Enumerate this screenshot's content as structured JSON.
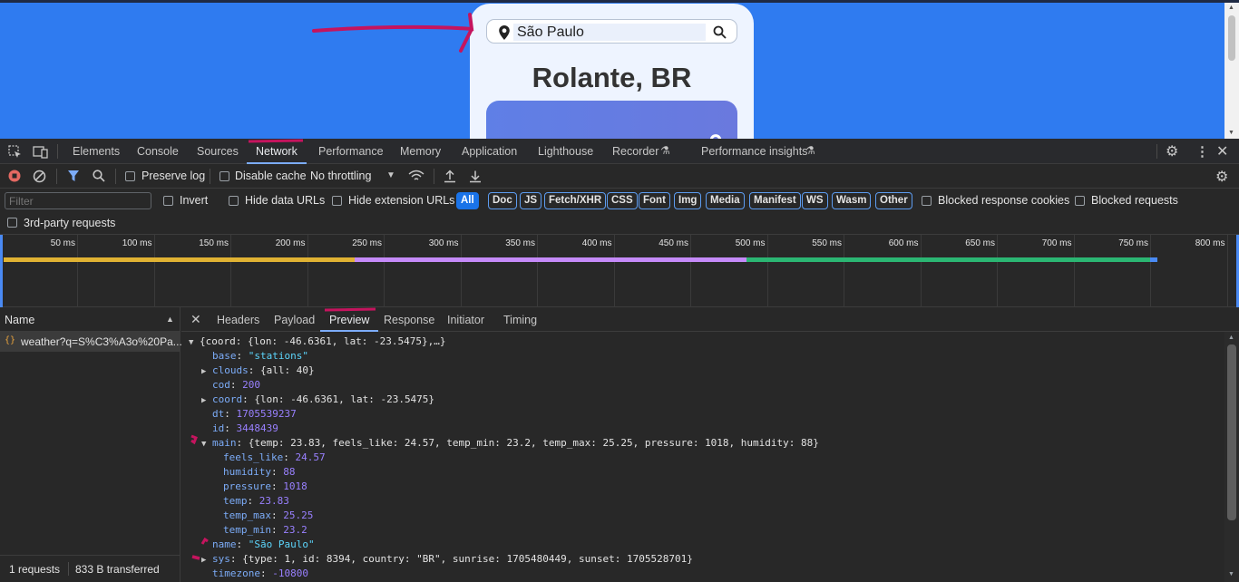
{
  "page": {
    "search_value": "São Paulo",
    "city_title": "Rolante, BR",
    "temp_fragment": "°"
  },
  "devtools": {
    "tabs": [
      "Elements",
      "Console",
      "Sources",
      "Network",
      "Performance",
      "Memory",
      "Application",
      "Lighthouse",
      "Recorder",
      "Performance insights"
    ],
    "active_tab": "Network",
    "toolbar": {
      "preserve_log": "Preserve log",
      "disable_cache": "Disable cache",
      "throttling": "No throttling"
    },
    "filter": {
      "placeholder": "Filter",
      "invert": "Invert",
      "hide_data_urls": "Hide data URLs",
      "hide_extension_urls": "Hide extension URLs",
      "chips": [
        "All",
        "Doc",
        "JS",
        "Fetch/XHR",
        "CSS",
        "Font",
        "Img",
        "Media",
        "Manifest",
        "WS",
        "Wasm",
        "Other"
      ],
      "blocked_response_cookies": "Blocked response cookies",
      "blocked_requests": "Blocked requests",
      "third_party": "3rd-party requests"
    },
    "timeline_ticks": [
      "50 ms",
      "100 ms",
      "150 ms",
      "200 ms",
      "250 ms",
      "300 ms",
      "350 ms",
      "400 ms",
      "450 ms",
      "500 ms",
      "550 ms",
      "600 ms",
      "650 ms",
      "700 ms",
      "750 ms",
      "800 ms"
    ],
    "timeline_colors": {
      "waiting": "#e0b233",
      "receiving": "#c58af9",
      "content": "#2bb673",
      "end": "#4a8af4"
    },
    "name_header": "Name",
    "request_name": "weather?q=S%C3%A3o%20Pa...",
    "status": {
      "requests": "1 requests",
      "transferred": "833 B transferred"
    },
    "detail_tabs": [
      "Headers",
      "Payload",
      "Preview",
      "Response",
      "Initiator",
      "Timing"
    ],
    "active_detail_tab": "Preview",
    "preview": {
      "root": "{coord: {lon: -46.6361, lat: -23.5475},…}",
      "base_key": "base",
      "base_val": "\"stations\"",
      "clouds_key": "clouds",
      "clouds_val": "{all: 40}",
      "cod_key": "cod",
      "cod_val": "200",
      "coord_key": "coord",
      "coord_val": "{lon: -46.6361, lat: -23.5475}",
      "dt_key": "dt",
      "dt_val": "1705539237",
      "id_key": "id",
      "id_val": "3448439",
      "main_key": "main",
      "main_val": "{temp: 23.83, feels_like: 24.57, temp_min: 23.2, temp_max: 25.25, pressure: 1018, humidity: 88}",
      "feels_key": "feels_like",
      "feels_val": "24.57",
      "humidity_key": "humidity",
      "humidity_val": "88",
      "pressure_key": "pressure",
      "pressure_val": "1018",
      "temp_key": "temp",
      "temp_val": "23.83",
      "tmax_key": "temp_max",
      "tmax_val": "25.25",
      "tmin_key": "temp_min",
      "tmin_val": "23.2",
      "name_key": "name",
      "name_val": "\"São Paulo\"",
      "sys_key": "sys",
      "sys_val": "{type: 1, id: 8394, country: \"BR\", sunrise: 1705480449, sunset: 1705528701}",
      "tz_key": "timezone",
      "tz_val": "-10800"
    },
    "colors": {
      "accent": "#7cacf8",
      "bg": "#282828"
    }
  }
}
